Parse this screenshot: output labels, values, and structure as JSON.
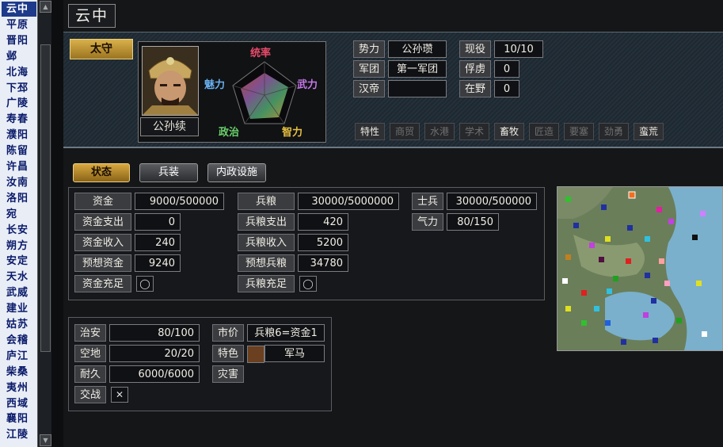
{
  "city_list": [
    "云中",
    "平原",
    "晋阳",
    "邺",
    "北海",
    "下邳",
    "广陵",
    "寿春",
    "濮阳",
    "陈留",
    "许昌",
    "汝南",
    "洛阳",
    "宛",
    "长安",
    "朔方",
    "安定",
    "天水",
    "武威",
    "建业",
    "姑苏",
    "会稽",
    "庐江",
    "柴桑",
    "夷州",
    "西域",
    "襄阳",
    "江陵"
  ],
  "selected_city": "云中",
  "title": "云中",
  "rank": "太守",
  "general": {
    "name": "公孙续",
    "stats": {
      "command": "统率",
      "force": "武力",
      "intellect": "智力",
      "politics": "政治",
      "charm": "魅力"
    }
  },
  "info": {
    "force_label": "势力",
    "force_value": "公孙瓒",
    "corps_label": "军团",
    "corps_value": "第一军团",
    "emperor_label": "汉帝",
    "emperor_value": "",
    "active_label": "现役",
    "active_value": "10/10",
    "captive_label": "俘虏",
    "captive_value": "0",
    "wild_label": "在野",
    "wild_value": "0"
  },
  "traits": {
    "label": "特性",
    "items": [
      {
        "name": "商贸",
        "on": false
      },
      {
        "name": "水港",
        "on": false
      },
      {
        "name": "学术",
        "on": false
      },
      {
        "name": "畜牧",
        "on": true
      },
      {
        "name": "匠造",
        "on": false
      },
      {
        "name": "要塞",
        "on": false
      },
      {
        "name": "劲勇",
        "on": false
      },
      {
        "name": "蛮荒",
        "on": true
      }
    ]
  },
  "tabs": [
    "状态",
    "兵装",
    "内政设施"
  ],
  "funds": {
    "gold_label": "资金",
    "gold_value": "9000/500000",
    "gold_out_label": "资金支出",
    "gold_out_value": "0",
    "gold_in_label": "资金收入",
    "gold_in_value": "240",
    "gold_est_label": "预想资金",
    "gold_est_value": "9240",
    "gold_full_label": "资金充足"
  },
  "food": {
    "food_label": "兵粮",
    "food_value": "30000/5000000",
    "food_out_label": "兵粮支出",
    "food_out_value": "420",
    "food_in_label": "兵粮收入",
    "food_in_value": "5200",
    "food_est_label": "预想兵粮",
    "food_est_value": "34780",
    "food_full_label": "兵粮充足"
  },
  "troops": {
    "soldier_label": "士兵",
    "soldier_value": "30000/500000",
    "morale_label": "气力",
    "morale_value": "80/150"
  },
  "city_stats": {
    "order_label": "治安",
    "order_value": "80/100",
    "land_label": "空地",
    "land_value": "20/20",
    "dur_label": "耐久",
    "dur_value": "6000/6000",
    "war_label": "交战",
    "war_value": "✕"
  },
  "market": {
    "price_label": "市价",
    "price_value": "兵粮6=资金1",
    "special_label": "特色",
    "special_value": "军马",
    "disaster_label": "灾害"
  },
  "colors": {
    "accent_gold": "#d8b04a",
    "panel": "#1e2830",
    "selection": "#1e3a8a"
  }
}
